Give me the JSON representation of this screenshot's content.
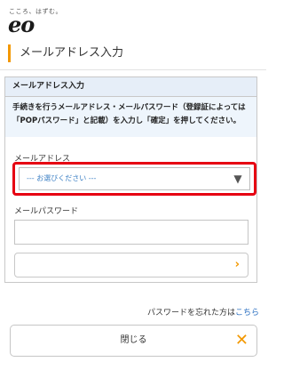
{
  "header": {
    "tagline": "こころ、はずむ。",
    "logo_text": "eo"
  },
  "page": {
    "title": "メールアドレス入力"
  },
  "panel": {
    "header": "メールアドレス入力",
    "instruction": "手続きを行うメールアドレス・メールパスワード（登録証によっては「POPパスワード」と記載）を入力し「確定」を押してください。"
  },
  "form": {
    "address_label": "メールアドレス",
    "address_select_value": "--- お選びください ---",
    "address_select_arrow": "▼",
    "password_label": "メールパスワード",
    "password_value": "",
    "confirm_button_label": "",
    "confirm_chevron": "›"
  },
  "footer": {
    "forgot_text": "パスワードを忘れた方は",
    "forgot_link": "こちら",
    "close_label": "閉じる",
    "close_glyph": "✕"
  },
  "colors": {
    "accent": "#f39800",
    "highlight": "#e60012",
    "link": "#2a6fc1",
    "panel_header_bg": "#e6eef8"
  }
}
